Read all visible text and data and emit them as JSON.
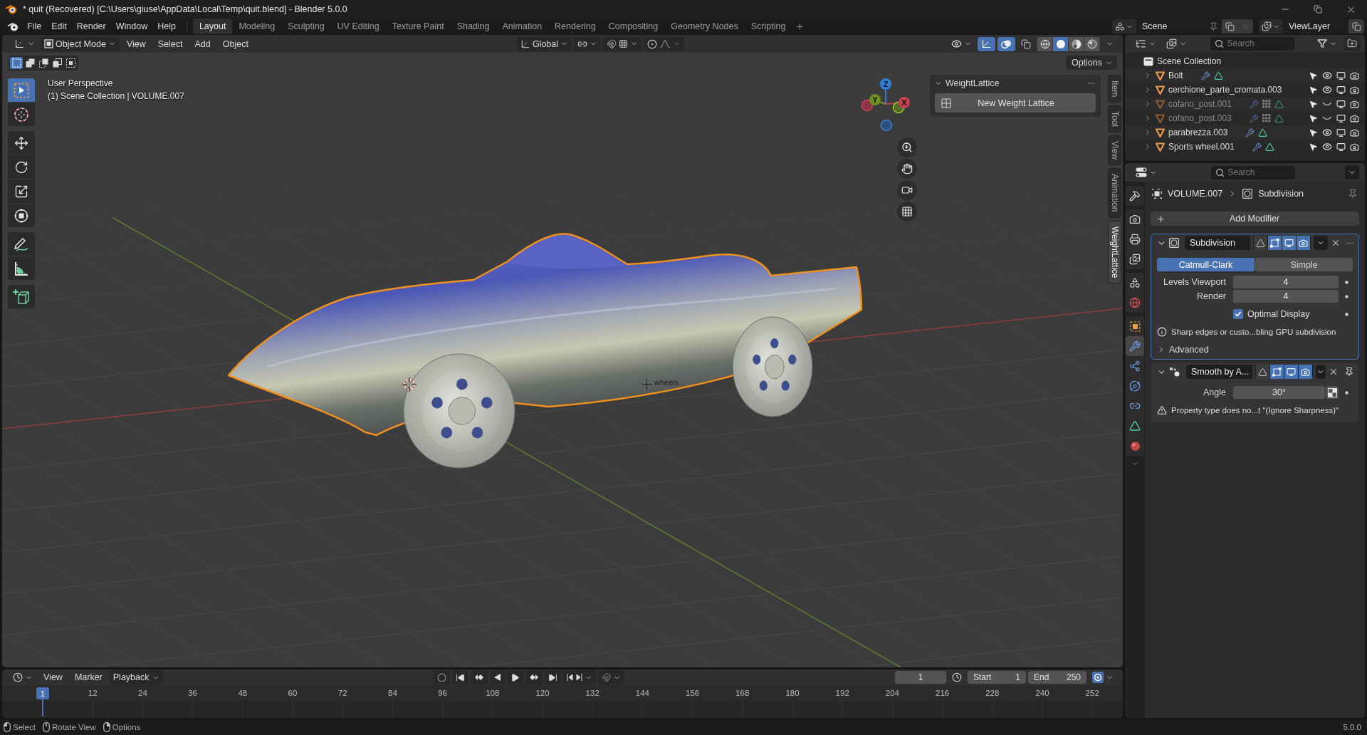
{
  "window": {
    "title": "* quit (Recovered) [C:\\Users\\giuse\\AppData\\Local\\Temp\\quit.blend] - Blender 5.0.0"
  },
  "menu": [
    "File",
    "Edit",
    "Render",
    "Window",
    "Help"
  ],
  "workspaces": [
    {
      "label": "Layout",
      "selected": true
    },
    {
      "label": "Modeling",
      "selected": false
    },
    {
      "label": "Sculpting",
      "selected": false
    },
    {
      "label": "UV Editing",
      "selected": false
    },
    {
      "label": "Texture Paint",
      "selected": false
    },
    {
      "label": "Shading",
      "selected": false
    },
    {
      "label": "Animation",
      "selected": false
    },
    {
      "label": "Rendering",
      "selected": false
    },
    {
      "label": "Compositing",
      "selected": false
    },
    {
      "label": "Geometry Nodes",
      "selected": false
    },
    {
      "label": "Scripting",
      "selected": false
    }
  ],
  "scene": "Scene",
  "view_layer": "ViewLayer",
  "viewport": {
    "mode": "Object Mode",
    "menus": [
      "View",
      "Select",
      "Add",
      "Object"
    ],
    "orientation": "Global",
    "header_toggles": [
      {
        "kind": "gizmos",
        "on": true
      },
      {
        "kind": "overlays",
        "on": true
      },
      {
        "kind": "xray",
        "on": false
      }
    ],
    "shading_modes": [
      {
        "kind": "wireframe",
        "selected": false
      },
      {
        "kind": "solid",
        "selected": true
      },
      {
        "kind": "material",
        "selected": false
      },
      {
        "kind": "rendered",
        "selected": false
      }
    ],
    "select_modes": [
      {
        "kind": "new",
        "selected": true
      },
      {
        "kind": "extend",
        "selected": false
      },
      {
        "kind": "subtract",
        "selected": false
      },
      {
        "kind": "invert",
        "selected": false
      },
      {
        "kind": "intersect",
        "selected": false
      }
    ],
    "options": "Options",
    "tool_groups": [
      [
        {
          "kind": "select_box",
          "selected": true
        },
        {
          "kind": "cursor",
          "selected": false
        }
      ],
      [
        {
          "kind": "move",
          "selected": false
        },
        {
          "kind": "rotate",
          "selected": false
        },
        {
          "kind": "scale",
          "selected": false
        },
        {
          "kind": "transform",
          "selected": false
        }
      ],
      [
        {
          "kind": "annotate",
          "selected": false
        },
        {
          "kind": "measure",
          "selected": false
        }
      ],
      [
        {
          "kind": "add_cube",
          "selected": false
        }
      ]
    ],
    "info": [
      "User Perspective",
      "(1) Scene Collection | VOLUME.007"
    ],
    "object_label": "wheels",
    "gizmo_axes": [
      "Z",
      "Y",
      "X"
    ],
    "sidebar": {
      "panel": {
        "title": "WeightLattice",
        "expanded": true,
        "button": "New Weight Lattice"
      },
      "tabs": [
        {
          "label": "Item",
          "selected": false
        },
        {
          "label": "Tool",
          "selected": false
        },
        {
          "label": "View",
          "selected": false
        },
        {
          "label": "Animation",
          "selected": false
        },
        {
          "label": "WeightLattice",
          "selected": true
        }
      ]
    }
  },
  "outliner": {
    "search_placeholder": "Search",
    "collection": "Scene Collection",
    "objects": [
      {
        "name": "Bolt",
        "hidden": false,
        "data": [
          {
            "kind": "modifier"
          },
          {
            "kind": "mesh"
          }
        ]
      },
      {
        "name": "cerchione_parte_cromata.003",
        "hidden": false
      },
      {
        "name": "cofano_post.001",
        "hidden": true,
        "data": [
          {
            "kind": "modifier"
          },
          {
            "kind": "dot_grid"
          },
          {
            "kind": "mesh"
          }
        ]
      },
      {
        "name": "cofano_post.003",
        "hidden": true,
        "data": [
          {
            "kind": "modifier"
          },
          {
            "kind": "dot_grid"
          },
          {
            "kind": "mesh"
          }
        ]
      },
      {
        "name": "parabrezza.003",
        "hidden": false,
        "data": [
          {
            "kind": "modifier"
          },
          {
            "kind": "mesh"
          }
        ]
      },
      {
        "name": "Sports wheel.001",
        "hidden": false,
        "data": [
          {
            "kind": "modifier"
          },
          {
            "kind": "mesh"
          }
        ]
      }
    ]
  },
  "properties": {
    "search_placeholder": "Search",
    "tab_groups": [
      [
        {
          "kind": "tool",
          "selected": false
        }
      ],
      [
        {
          "kind": "render",
          "selected": false
        },
        {
          "kind": "output",
          "selected": false
        },
        {
          "kind": "view_layer",
          "selected": false
        }
      ],
      [
        {
          "kind": "scene",
          "selected": false
        },
        {
          "kind": "world",
          "selected": false
        }
      ],
      [
        {
          "kind": "object",
          "selected": false
        },
        {
          "kind": "modifiers",
          "selected": true
        },
        {
          "kind": "particles",
          "selected": false
        },
        {
          "kind": "physics",
          "selected": false
        },
        {
          "kind": "constraints",
          "selected": false
        },
        {
          "kind": "data",
          "selected": false
        },
        {
          "kind": "material",
          "selected": false
        }
      ]
    ],
    "breadcrumb": [
      "VOLUME.007",
      "Subdivision"
    ],
    "add_modifier": "Add Modifier",
    "modifiers": [
      {
        "kind": "subdivision",
        "name": "Subdivision",
        "active": true,
        "expanded": true,
        "pinned": false,
        "toggles": [
          {
            "kind": "on_cage",
            "on": false
          },
          {
            "kind": "edit_mode",
            "on": true
          },
          {
            "kind": "viewport",
            "on": true
          },
          {
            "kind": "render",
            "on": true
          }
        ],
        "methods": [
          {
            "label": "Catmull-Clark",
            "selected": true
          },
          {
            "label": "Simple",
            "selected": false
          }
        ],
        "fields": [
          {
            "label": "Levels Viewport",
            "value": "4",
            "kind": "number"
          },
          {
            "label": "Render",
            "value": "4",
            "kind": "number"
          }
        ],
        "checkbox": {
          "label": "Optimal Display",
          "checked": true
        },
        "message": {
          "kind": "info",
          "text": "Sharp edges or custo...bling GPU subdivision"
        },
        "subpanel": {
          "label": "Advanced",
          "expanded": false
        }
      },
      {
        "kind": "smooth_by_angle",
        "name": "Smooth by A...",
        "active": false,
        "expanded": true,
        "pinned": true,
        "toggles": [
          {
            "kind": "on_cage",
            "on": false
          },
          {
            "kind": "edit_mode",
            "on": true
          },
          {
            "kind": "viewport",
            "on": true
          },
          {
            "kind": "render",
            "on": true
          }
        ],
        "fields": [
          {
            "label": "Angle",
            "value": "30°",
            "kind": "node_input"
          }
        ],
        "message": {
          "kind": "warning",
          "text": "Property type does no...t \"(Ignore Sharpness)\""
        }
      }
    ]
  },
  "timeline": {
    "menus": [
      "View",
      "Marker"
    ],
    "playback": "Playback",
    "current_frame": "1",
    "start_label": "Start",
    "start": "1",
    "end_label": "End",
    "end": "250",
    "playhead": "1",
    "ticks": [
      "12",
      "24",
      "36",
      "48",
      "60",
      "72",
      "84",
      "96",
      "108",
      "120",
      "132",
      "144",
      "156",
      "168",
      "180",
      "192",
      "204",
      "216",
      "228",
      "240",
      "252"
    ]
  },
  "status_bar": {
    "hints": [
      {
        "kind": "left_click",
        "label": "Select"
      },
      {
        "kind": "middle_click",
        "label": "Rotate View"
      },
      {
        "kind": "right_click",
        "label": "Options"
      }
    ],
    "version": "5.0.0"
  }
}
